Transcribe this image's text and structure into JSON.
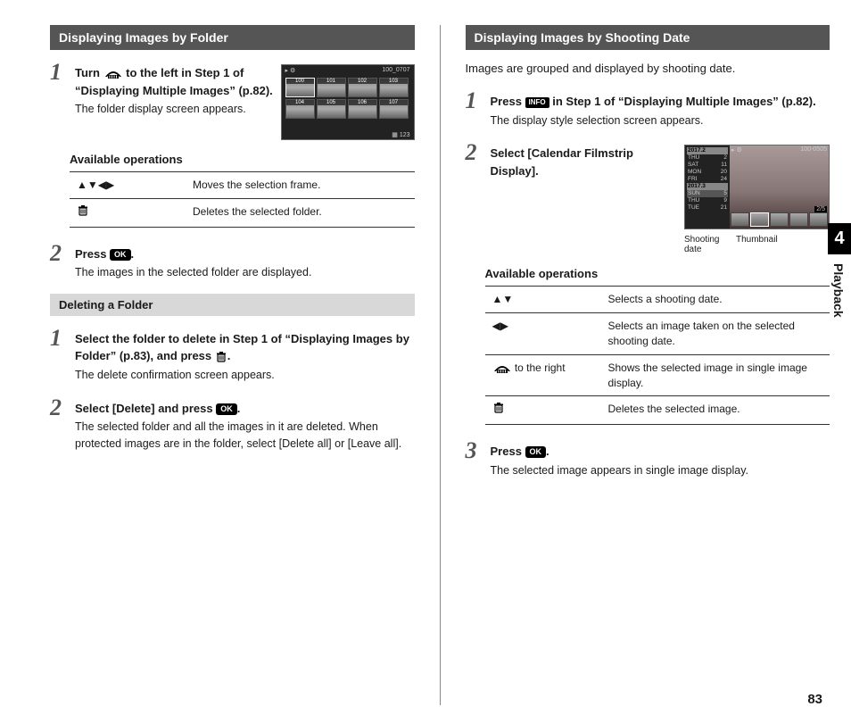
{
  "chapter": {
    "number": "4",
    "title": "Playback"
  },
  "page_number": "83",
  "left": {
    "header": "Displaying Images by Folder",
    "step1": {
      "title_a": "Turn ",
      "title_b": " to the left in Step 1 of “Displaying Multiple Images” (p.82).",
      "desc": "The folder display screen appears."
    },
    "ops_label": "Available operations",
    "ops": [
      {
        "ctrl_name": "Arrow keys",
        "desc": "Moves the selection frame."
      },
      {
        "ctrl_name": "Trash",
        "desc": "Deletes the selected folder."
      }
    ],
    "step2": {
      "title_a": "Press ",
      "title_b": ".",
      "desc": "The images in the selected folder are displayed."
    },
    "sub_header": "Deleting a Folder",
    "del_step1": {
      "title": "Select the folder to delete in Step 1 of “Displaying Images by Folder” (p.83), and press ",
      "title_b": ".",
      "desc": "The delete confirmation screen appears."
    },
    "del_step2": {
      "title_a": "Select [Delete] and press ",
      "title_b": ".",
      "desc": "The selected folder and all the images in it are deleted. When protected images are in the folder, select [Delete all] or [Leave all]."
    },
    "lcd": {
      "top_right": "100_0707",
      "folders": [
        "100",
        "101",
        "102",
        "103",
        "104",
        "105",
        "106",
        "107"
      ],
      "count": "123"
    }
  },
  "right": {
    "header": "Displaying Images by Shooting Date",
    "intro": "Images are grouped and displayed by shooting date.",
    "step1": {
      "title_a": "Press ",
      "title_b": " in Step 1 of “Displaying Multiple Images” (p.82).",
      "desc": "The display style selection screen appears."
    },
    "step2": {
      "title": "Select [Calendar Filmstrip Display]."
    },
    "lcd": {
      "hdr1": "2017.2",
      "rows1": [
        [
          "THU",
          "2"
        ],
        [
          "SAT",
          "11"
        ],
        [
          "MON",
          "20"
        ],
        [
          "FRI",
          "24"
        ]
      ],
      "hdr2": "2017.3",
      "rows2": [
        [
          "SUN",
          "5"
        ],
        [
          "THU",
          "9"
        ],
        [
          "TUE",
          "21"
        ]
      ],
      "file": "100-0505",
      "counter": "2/5",
      "label_a": "Shooting date",
      "label_b": "Thumbnail"
    },
    "ops_label": "Available operations",
    "ops": [
      {
        "ctrl_name": "Up/Down arrows",
        "desc": "Selects a shooting date."
      },
      {
        "ctrl_name": "Left/Right arrows",
        "desc": "Selects an image taken on the selected shooting date."
      },
      {
        "ctrl_name": "Dial right",
        "ctrl_text": " to the right",
        "desc": "Shows the selected image in single image display."
      },
      {
        "ctrl_name": "Trash",
        "desc": "Deletes the selected image."
      }
    ],
    "step3": {
      "title_a": "Press ",
      "title_b": ".",
      "desc": "The selected image appears in single image display."
    }
  },
  "buttons": {
    "ok": "OK",
    "info": "INFO"
  }
}
